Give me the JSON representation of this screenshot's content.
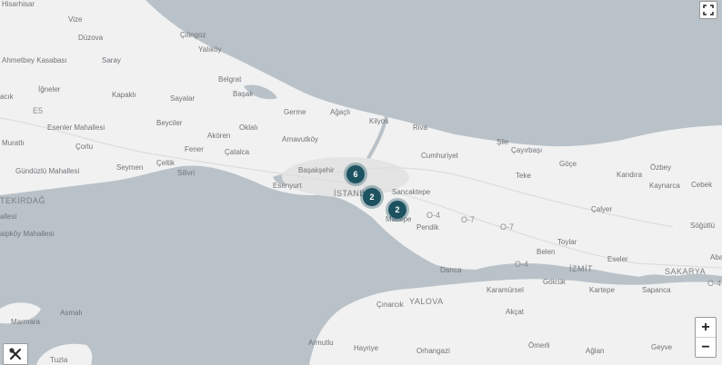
{
  "map": {
    "labels": {
      "hisarhisar": "Hisarhisar",
      "vize": "Vize",
      "duzova": "Düzova",
      "cilingoz": "Çilingoz",
      "yalikoy": "Yalıköy",
      "ahmetbey": "Ahmetbey Kasabası",
      "saray": "Saray",
      "igneler": "İğneler",
      "kapakli": "Kapaklı",
      "sayalar": "Sayalar",
      "belgrat": "Belgrat",
      "basak": "Başak",
      "acik": "acık",
      "e5": "E5",
      "germe": "Germe",
      "agacli": "Ağaçlı",
      "kilyos": "Kilyos",
      "esenler": "Esenler Mahallesi",
      "beyciler": "Beyciler",
      "oklali": "Oklalı",
      "riva": "Riva",
      "muratli": "Muratlı",
      "corlu": "Çorlu",
      "fener": "Fener",
      "akoren": "Akören",
      "arnavutkoy": "Arnavutköy",
      "cumhuriyet": "Cumhuriyet",
      "sile": "Şile",
      "catalca": "Çatalca",
      "cayirbasi": "Çayırbaşı",
      "gundizlu": "Gündüzlü Mahallesi",
      "seymen": "Seymen",
      "celtik": "Çeltik",
      "basaksehir": "Başakşehir",
      "goce": "Göçe",
      "kandira": "Kandıra",
      "ozbey": "Özbey",
      "silivri": "Silivri",
      "teke": "Teke",
      "esenyurt": "Esenyurt",
      "tekirdag": "TEKİRDAĞ",
      "istanbul": "İSTANBUL",
      "sancaktepe": "Sancaktepe",
      "kaynarca": "Kaynarca",
      "cebek": "Cebek",
      "allesi": "allesi",
      "calyer": "Çalyer",
      "o4a": "O-4",
      "o7a": "O-7",
      "maltepe": "Maltepe",
      "pendik": "Pendik",
      "sogutlu": "Söğütlü",
      "kaipkoy": "aipköy Mahallesi",
      "o7b": "O-7",
      "toylar": "Toylar",
      "belen": "Belen",
      "aba": "Aba",
      "o4b": "O-4",
      "izmit": "İZMİT",
      "eseler": "Eseler",
      "sakarya": "SAKARYA",
      "darica": "Darıca",
      "golcuk": "Gölcük",
      "o4c": "O-4",
      "karamursel": "Karamürsel",
      "kartepe": "Kartepe",
      "sapanca": "Sapanca",
      "yalova": "YALOVA",
      "cinarcik": "Çınarcık",
      "asmali": "Asmalı",
      "akcat": "Akçat",
      "marmara": "Marmara",
      "armutlu": "Armutlu",
      "hayriye": "Hayriye",
      "omerli": "Ömerli",
      "orhangazi": "Orhangazi",
      "aglan": "Ağlan",
      "geyve": "Geyve",
      "tuzla": "Tuzla"
    },
    "clusters": [
      {
        "count": "6"
      },
      {
        "count": "2"
      },
      {
        "count": "2"
      }
    ],
    "controls": {
      "zoom_in": "+",
      "zoom_out": "−",
      "fullscreen_icon": "fullscreen-icon",
      "tools_icon": "tools-icon"
    },
    "colors": {
      "water": "#b9c2c8",
      "land": "#f1f1f1",
      "cluster": "#1d5360"
    }
  }
}
